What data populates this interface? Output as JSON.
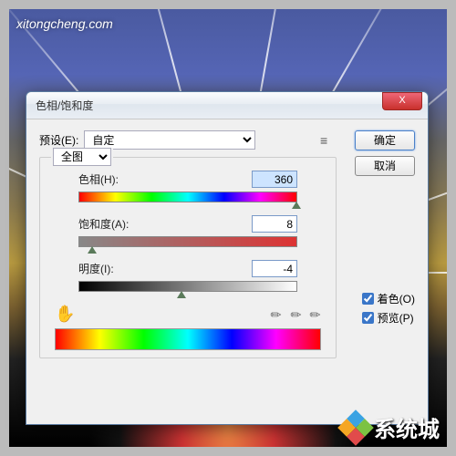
{
  "watermark": "xitongcheng.com",
  "brand": {
    "text": "系统城",
    "colors": [
      "#3aa3e3",
      "#7cc242",
      "#f5a623",
      "#e14b4b"
    ]
  },
  "dialog": {
    "title": "色相/饱和度",
    "close": "X",
    "preset_label": "预设(E):",
    "preset_value": "自定",
    "ok": "确定",
    "cancel": "取消",
    "channel": "全图",
    "sliders": {
      "hue": {
        "label": "色相(H):",
        "value": "360",
        "pos": 100
      },
      "sat": {
        "label": "饱和度(A):",
        "value": "8",
        "pos": 6
      },
      "light": {
        "label": "明度(I):",
        "value": "-4",
        "pos": 47
      }
    },
    "colorize_label": "着色(O)",
    "preview_label": "预览(P)",
    "colorize_checked": true,
    "preview_checked": true
  }
}
